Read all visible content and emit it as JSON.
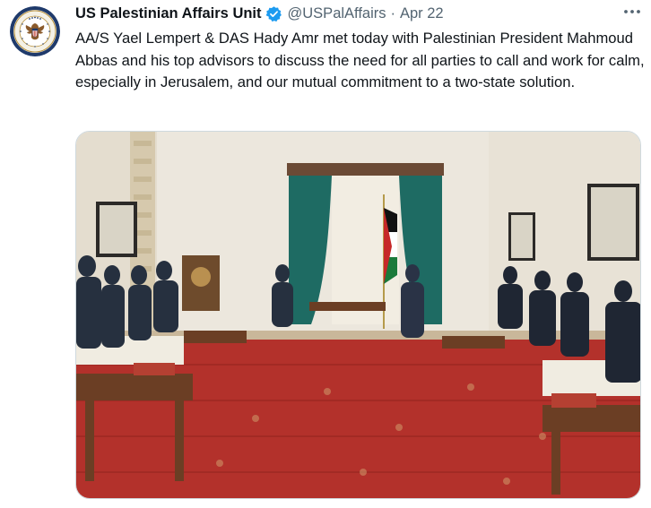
{
  "tweet": {
    "display_name": "US Palestinian Affairs Unit",
    "handle": "@USPalAffairs",
    "separator": "·",
    "date": "Apr 22",
    "text": "AA/S Yael Lempert & DAS Hady Amr met today with Palestinian President Mahmoud Abbas and his top advisors to discuss the need for all parties to call and work for calm, especially in Jerusalem, and our mutual commitment to a two-state solution.",
    "verified_icon": "verified-badge-icon",
    "more_icon": "more-dots-icon",
    "avatar_icon": "state-department-seal",
    "accent_color": "#1d9bf0"
  }
}
